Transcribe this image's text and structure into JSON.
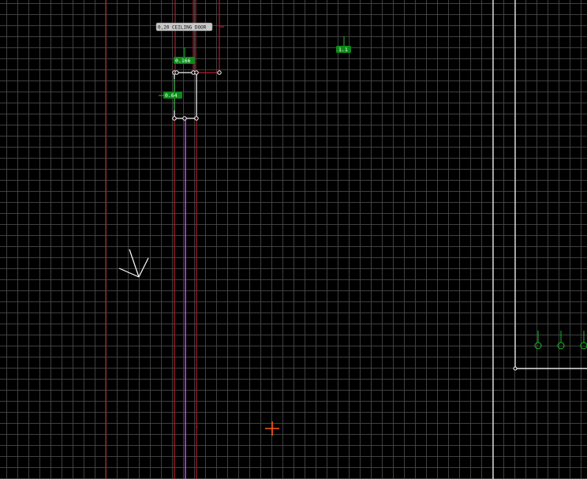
{
  "annotations": {
    "ceiling_door_label": "0,20 CEILING DOOR",
    "dim_top": "0.166",
    "dim_left": "0.64",
    "dim_right": "1.1"
  },
  "colors": {
    "background": "#000000",
    "grid": "#4a4a4a",
    "red_line": "#b01c2c",
    "purple_line": "#b44ed8",
    "white_line": "#ffffff",
    "green_tag": "#0d8a1a",
    "green_marker": "#1fb82b",
    "cursor": "#ff5a1a",
    "label_bg": "#c9c9c9"
  },
  "icons": {
    "camera_icon": "camera-frustum-icon",
    "cursor_icon": "crosshair-cursor-icon",
    "entity_marker_icon": "circle-marker-icon"
  }
}
